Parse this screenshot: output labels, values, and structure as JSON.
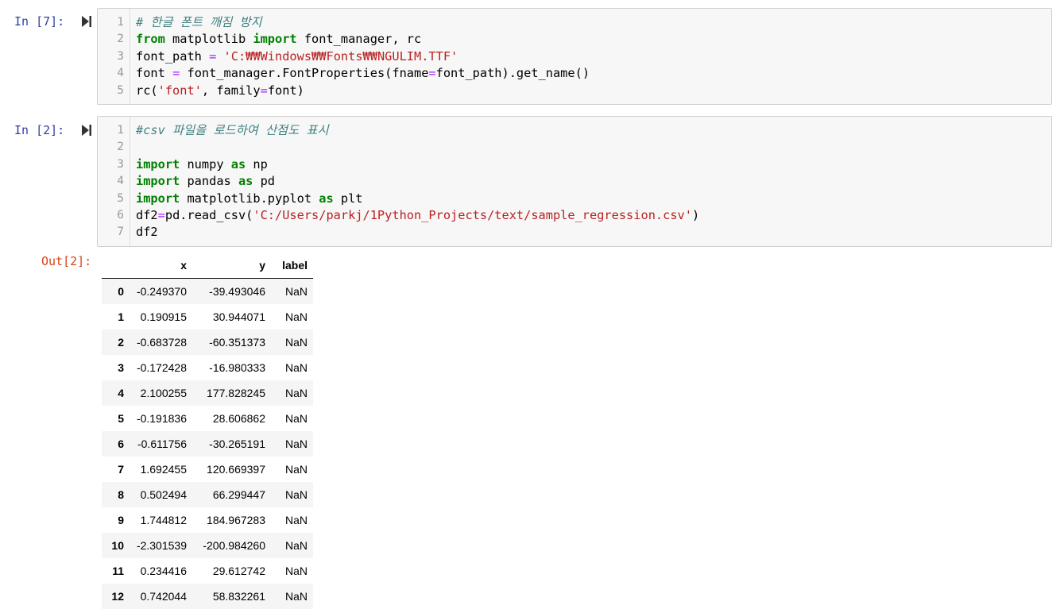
{
  "cells": [
    {
      "prompt": "In [7]:",
      "lines": [
        [
          {
            "t": "# 한글 폰트 깨짐 방지",
            "c": "cm"
          }
        ],
        [
          {
            "t": "from",
            "c": "kw"
          },
          {
            "t": " matplotlib ",
            "c": ""
          },
          {
            "t": "import",
            "c": "kw"
          },
          {
            "t": " font_manager, rc",
            "c": ""
          }
        ],
        [
          {
            "t": "font_path ",
            "c": ""
          },
          {
            "t": "=",
            "c": "op"
          },
          {
            "t": " ",
            "c": ""
          },
          {
            "t": "'C:₩₩Windows₩₩Fonts₩₩NGULIM.TTF'",
            "c": "st"
          }
        ],
        [
          {
            "t": "font ",
            "c": ""
          },
          {
            "t": "=",
            "c": "op"
          },
          {
            "t": " font_manager.FontProperties(fname",
            "c": ""
          },
          {
            "t": "=",
            "c": "op"
          },
          {
            "t": "font_path).get_name()",
            "c": ""
          }
        ],
        [
          {
            "t": "rc(",
            "c": ""
          },
          {
            "t": "'font'",
            "c": "st"
          },
          {
            "t": ", family",
            "c": ""
          },
          {
            "t": "=",
            "c": "op"
          },
          {
            "t": "font)",
            "c": ""
          }
        ]
      ]
    },
    {
      "prompt": "In [2]:",
      "lines": [
        [
          {
            "t": "#csv 파일을 로드하여 산점도 표시",
            "c": "cm"
          }
        ],
        [],
        [
          {
            "t": "import",
            "c": "kw"
          },
          {
            "t": " numpy ",
            "c": ""
          },
          {
            "t": "as",
            "c": "kw"
          },
          {
            "t": " np",
            "c": ""
          }
        ],
        [
          {
            "t": "import",
            "c": "kw"
          },
          {
            "t": " pandas ",
            "c": ""
          },
          {
            "t": "as",
            "c": "kw"
          },
          {
            "t": " pd",
            "c": ""
          }
        ],
        [
          {
            "t": "import",
            "c": "kw"
          },
          {
            "t": " matplotlib.pyplot ",
            "c": ""
          },
          {
            "t": "as",
            "c": "kw"
          },
          {
            "t": " plt",
            "c": ""
          }
        ],
        [
          {
            "t": "df2",
            "c": ""
          },
          {
            "t": "=",
            "c": "op"
          },
          {
            "t": "pd.read_csv(",
            "c": ""
          },
          {
            "t": "'C:/Users/parkj/1Python_Projects/text/sample_regression.csv'",
            "c": "st"
          },
          {
            "t": ")",
            "c": ""
          }
        ],
        [
          {
            "t": "df2",
            "c": ""
          }
        ]
      ]
    }
  ],
  "output": {
    "prompt": "Out[2]:",
    "columns": [
      "",
      "x",
      "y",
      "label"
    ],
    "rows": [
      [
        "0",
        "-0.249370",
        "-39.493046",
        "NaN"
      ],
      [
        "1",
        "0.190915",
        "30.944071",
        "NaN"
      ],
      [
        "2",
        "-0.683728",
        "-60.351373",
        "NaN"
      ],
      [
        "3",
        "-0.172428",
        "-16.980333",
        "NaN"
      ],
      [
        "4",
        "2.100255",
        "177.828245",
        "NaN"
      ],
      [
        "5",
        "-0.191836",
        "28.606862",
        "NaN"
      ],
      [
        "6",
        "-0.611756",
        "-30.265191",
        "NaN"
      ],
      [
        "7",
        "1.692455",
        "120.669397",
        "NaN"
      ],
      [
        "8",
        "0.502494",
        "66.299447",
        "NaN"
      ],
      [
        "9",
        "1.744812",
        "184.967283",
        "NaN"
      ],
      [
        "10",
        "-2.301539",
        "-200.984260",
        "NaN"
      ],
      [
        "11",
        "0.234416",
        "29.612742",
        "NaN"
      ],
      [
        "12",
        "0.742044",
        "58.832261",
        "NaN"
      ]
    ]
  }
}
